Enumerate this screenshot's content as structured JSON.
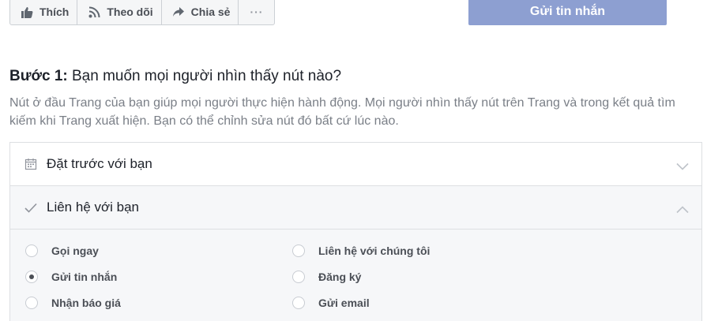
{
  "action_bar": {
    "like_label": "Thích",
    "follow_label": "Theo dõi",
    "share_label": "Chia sẻ",
    "more_label": "···"
  },
  "send_message_button": "Gửi tin nhắn",
  "step": {
    "title_bold": "Bước 1:",
    "title_rest": " Bạn muốn mọi người nhìn thấy nút nào?",
    "description": "Nút ở đầu Trang của bạn giúp mọi người thực hiện hành động. Mọi người nhìn thấy nút trên Trang và trong kết quả tìm kiếm khi Trang xuất hiện. Bạn có thể chỉnh sửa nút đó bất cứ lúc nào."
  },
  "accordion": {
    "section1_label": "Đặt trước với bạn",
    "section2_label": "Liên hệ với bạn",
    "options": {
      "call_now": "Gọi ngay",
      "send_message": "Gửi tin nhắn",
      "get_quote": "Nhận báo giá",
      "contact_us": "Liên hệ với chúng tôi",
      "sign_up": "Đăng ký",
      "send_email": "Gửi email"
    },
    "selected": "send_message"
  },
  "colors": {
    "primary_button": "#8d9fd1",
    "text_muted": "#7a7f87",
    "border": "#dddfe2"
  }
}
